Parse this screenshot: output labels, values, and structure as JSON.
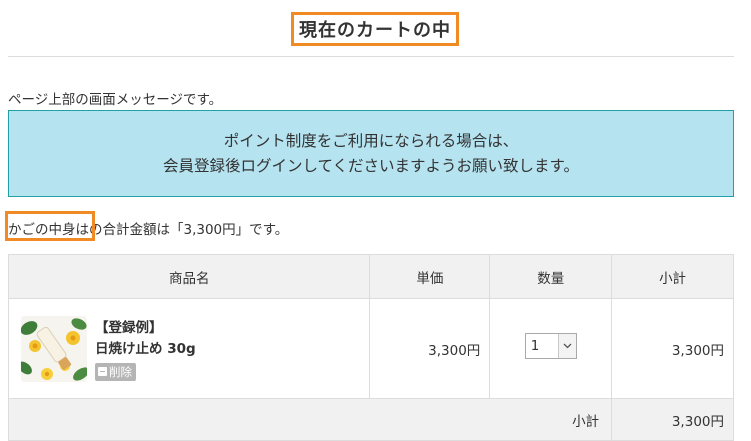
{
  "page": {
    "title": "現在のカートの中",
    "top_message": "ページ上部の画面メッセージです。",
    "notice": {
      "line1": "ポイント制度をご利用になられる場合は、",
      "line2": "会員登録後ログインしてくださいますようお願い致します。"
    },
    "cart_summary": {
      "prefix": "かごの中身は",
      "text": "の合計金額は「3,300円」です。"
    }
  },
  "table": {
    "headers": {
      "name": "商品名",
      "unit_price": "単価",
      "quantity": "数量",
      "subtotal": "小計"
    },
    "items": [
      {
        "label": "【登録例】",
        "name": "日焼け止め 30g",
        "delete_label": "削除",
        "unit_price": "3,300円",
        "quantity": "1",
        "subtotal": "3,300円"
      }
    ],
    "footer": {
      "label": "小計",
      "value": "3,300円"
    }
  },
  "colors": {
    "accent_orange": "#f08a24",
    "notice_bg": "#b5e3f0",
    "notice_border": "#22a0a8"
  }
}
